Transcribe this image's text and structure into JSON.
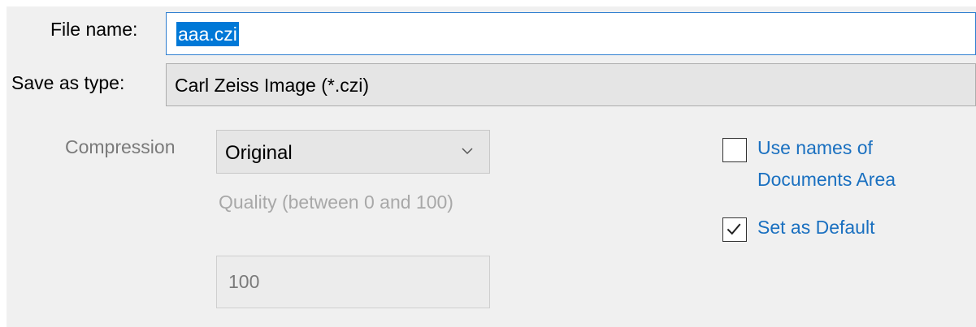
{
  "file_name": {
    "label": "File name:",
    "value": "aaa.czi"
  },
  "save_as_type": {
    "label": "Save as type:",
    "value": "Carl Zeiss Image (*.czi)"
  },
  "compression": {
    "label": "Compression",
    "selected": "Original"
  },
  "quality": {
    "label": "Quality (between 0 and 100)",
    "value": "100"
  },
  "options": {
    "use_names_label": "Use names of Documents Area",
    "use_names_checked": false,
    "set_default_label": "Set as Default",
    "set_default_checked": true
  },
  "colors": {
    "link_blue": "#1a70c0",
    "selection": "#0078d7"
  }
}
